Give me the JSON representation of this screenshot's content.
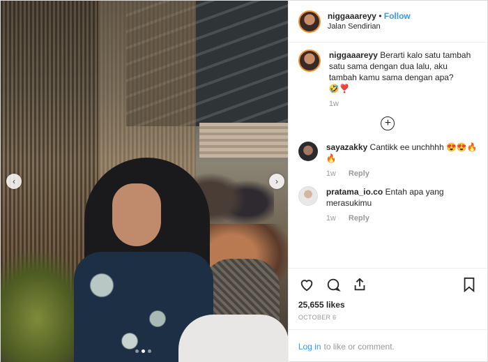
{
  "header": {
    "username": "niggaaareyy",
    "separator": "•",
    "follow_label": "Follow",
    "location": "Jalan Sendirian"
  },
  "caption": {
    "username": "niggaaareyy",
    "text": "Berarti kalo satu tambah satu sama dengan dua lalu, aku tambah kamu sama dengan apa?",
    "emoji": "🤣❣️",
    "time": "1w"
  },
  "comments": [
    {
      "username": "sayazakky",
      "text": "Cantikk ee unchhhh 😍😍🔥🔥",
      "time": "1w",
      "reply_label": "Reply"
    },
    {
      "username": "pratama_io.co",
      "text": "Entah apa yang merasukimu",
      "time": "1w",
      "reply_label": "Reply"
    }
  ],
  "load_more_symbol": "+",
  "actions": {
    "like_icon": "heart-icon",
    "comment_icon": "comment-icon",
    "share_icon": "share-icon",
    "save_icon": "bookmark-icon"
  },
  "likes": "25,655 likes",
  "date": "OCTOBER 6",
  "login": {
    "link_label": "Log in",
    "rest": "to like or comment."
  },
  "carousel": {
    "prev": "‹",
    "next": "›",
    "slides": 3,
    "active_slide": 2
  }
}
